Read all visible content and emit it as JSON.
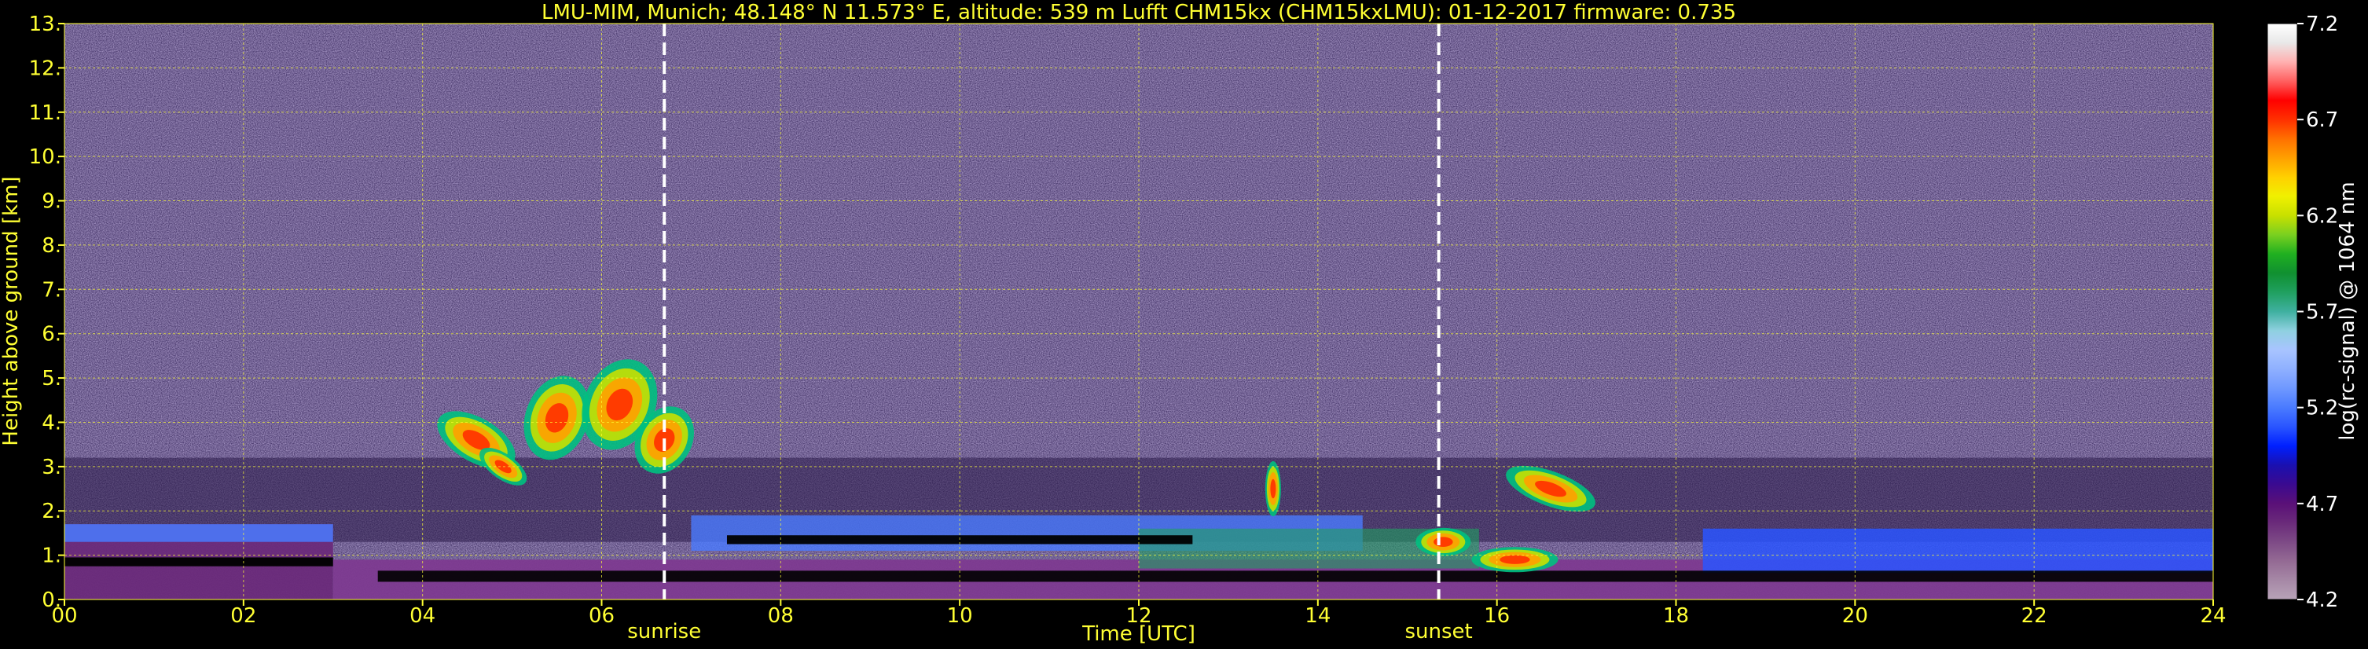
{
  "chart_data": {
    "type": "heatmap",
    "title": "LMU-MIM, Munich; 48.148° N 11.573° E, altitude: 539 m    Lufft CHM15kx (CHM15kxLMU): 01-12-2017    firmware: 0.735",
    "xlabel": "Time [UTC]",
    "ylabel": "Height above ground [km]",
    "xlim": [
      0,
      24
    ],
    "ylim": [
      0,
      13
    ],
    "x_ticks": [
      "00",
      "02",
      "04",
      "06",
      "08",
      "10",
      "12",
      "14",
      "16",
      "18",
      "20",
      "22",
      "24"
    ],
    "y_ticks": [
      "0.",
      "1.",
      "2.",
      "3.",
      "4.",
      "5.",
      "6.",
      "7.",
      "8.",
      "9.",
      "10.",
      "11.",
      "12.",
      "13."
    ],
    "grid": true,
    "events": [
      {
        "label": "sunrise",
        "time": 6.7
      },
      {
        "label": "sunset",
        "time": 15.35
      }
    ],
    "colorbar": {
      "label": "log(rc-signal) @ 1064 nm",
      "min": 4.2,
      "max": 7.2,
      "ticks": [
        "4.2",
        "4.7",
        "5.2",
        "5.7",
        "6.2",
        "6.7",
        "7.2"
      ],
      "colors": [
        "#b8a3b8",
        "#a688a6",
        "#946a94",
        "#7d4a86",
        "#6a2a7a",
        "#5a1078",
        "#3a0a90",
        "#1a10b0",
        "#0020ff",
        "#2a55ff",
        "#4a7bff",
        "#6f98ff",
        "#8fb0ff",
        "#a8c4ff",
        "#8fd0e0",
        "#3fb0a0",
        "#20a060",
        "#109030",
        "#20b020",
        "#7ad020",
        "#c8e000",
        "#f0f000",
        "#ffd000",
        "#ffa000",
        "#ff7000",
        "#ff3000",
        "#ff0000",
        "#ff6060",
        "#ffb0b0",
        "#e8e8e8",
        "#ffffff"
      ]
    }
  }
}
